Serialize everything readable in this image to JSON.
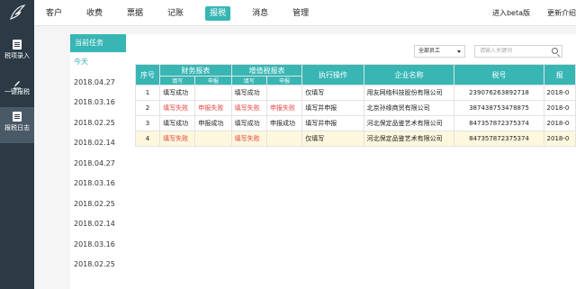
{
  "nav": [
    "客户",
    "收费",
    "票据",
    "记账",
    "报税",
    "消息",
    "管理"
  ],
  "nav_active": 4,
  "top_right": {
    "beta": "进入beta版",
    "update": "更新介绍"
  },
  "sidebar": [
    {
      "label": "税项录入",
      "icon": "tax-entry-icon"
    },
    {
      "label": "一键报税",
      "icon": "pencil-icon"
    },
    {
      "label": "报税日志",
      "icon": "log-icon"
    }
  ],
  "dates": {
    "header": "当前任务",
    "items": [
      "今天",
      "2018.04.27",
      "2018.03.16",
      "2018.02.25",
      "2018.02.14",
      "2018.04.27",
      "2018.03.16",
      "2018.02.25",
      "2018.02.14",
      "2018.03.16",
      "2018.02.25"
    ]
  },
  "filter": {
    "staff": "全部员工",
    "search_placeholder": "请输入关键词"
  },
  "table": {
    "headers": {
      "seq": "序号",
      "finance": "财务报表",
      "vat": "增值税报表",
      "action": "执行操作",
      "company": "企业名称",
      "taxno": "税号",
      "last": "报"
    },
    "sub": [
      "填写",
      "申报",
      "填写",
      "申报"
    ],
    "rows": [
      {
        "seq": "1",
        "f_fill": "填写成功",
        "f_report": "",
        "v_fill": "填写成功",
        "v_report": "",
        "action": "仅填写",
        "company": "用友网络科技股份有限公司",
        "taxno": "239076263892718",
        "date": "2018-0"
      },
      {
        "seq": "2",
        "f_fill": "填写失败",
        "f_report": "申报失败",
        "v_fill": "填写失败",
        "v_report": "申报失败",
        "action": "填写并申报",
        "company": "北京孙缘商贸有限公司",
        "taxno": "387438753478875",
        "date": "2018-0"
      },
      {
        "seq": "3",
        "f_fill": "填写成功",
        "f_report": "申报成功",
        "v_fill": "填写成功",
        "v_report": "申报成功",
        "action": "填写并申报",
        "company": "河北保定品鉴艺术有限公司",
        "taxno": "847357872375374",
        "date": "2018-0"
      },
      {
        "seq": "4",
        "f_fill": "填写失败",
        "f_report": "",
        "v_fill": "填写失败",
        "v_report": "",
        "action": "仅填写",
        "company": "河北保定品鉴艺术有限公司",
        "taxno": "847357872375374",
        "date": "2018-0"
      }
    ]
  },
  "colors": {
    "accent": "#37b6b4",
    "sidebar": "#2b3a45",
    "fail": "#e6403c",
    "highlight": "#fdf7dd"
  }
}
